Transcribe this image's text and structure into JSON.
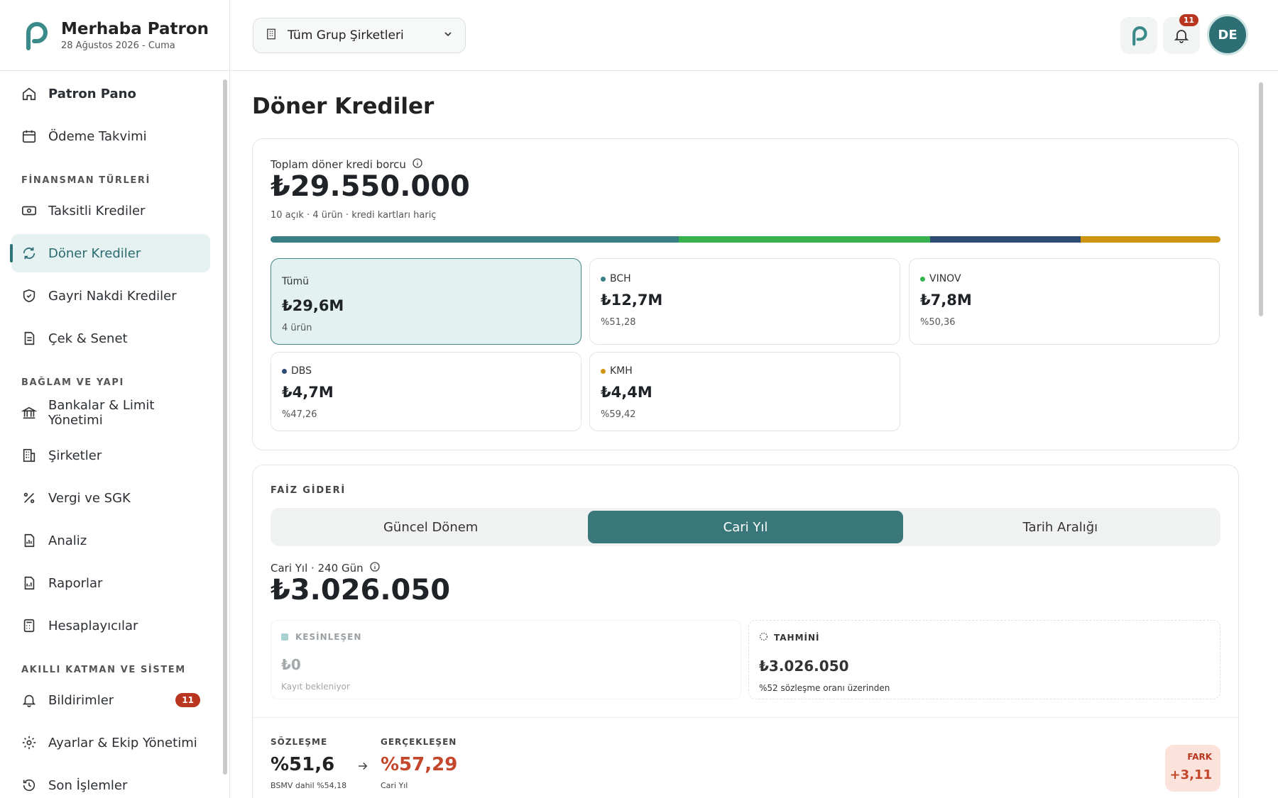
{
  "brand": {
    "title": "Merhaba Patron",
    "date": "28 Ağustos 2026 - Cuma"
  },
  "sidebar": {
    "sections": [
      "FİNANSMAN TÜRLERİ",
      "BAĞLAM VE YAPI",
      "AKILLI KATMAN VE SİSTEM"
    ],
    "items": [
      {
        "label": "Patron Pano",
        "icon": "home-icon"
      },
      {
        "label": "Ödeme Takvimi",
        "icon": "calendar-icon"
      },
      {
        "label": "Taksitli Krediler",
        "icon": "cash-icon"
      },
      {
        "label": "Döner Krediler",
        "icon": "refresh-icon"
      },
      {
        "label": "Gayri Nakdi Krediler",
        "icon": "shield-icon"
      },
      {
        "label": "Çek & Senet",
        "icon": "document-icon"
      },
      {
        "label": "Bankalar & Limit Yönetimi",
        "icon": "bank-icon"
      },
      {
        "label": "Şirketler",
        "icon": "building-icon"
      },
      {
        "label": "Vergi ve SGK",
        "icon": "percent-icon"
      },
      {
        "label": "Analiz",
        "icon": "chart-file-icon"
      },
      {
        "label": "Raporlar",
        "icon": "report-icon"
      },
      {
        "label": "Hesaplayıcılar",
        "icon": "calculator-icon"
      },
      {
        "label": "Bildirimler",
        "icon": "bell-icon",
        "badge": "11"
      },
      {
        "label": "Ayarlar & Ekip Yönetimi",
        "icon": "gear-icon"
      },
      {
        "label": "Son İşlemler",
        "icon": "history-icon"
      }
    ]
  },
  "topbar": {
    "company_select": "Tüm Grup Şirketleri",
    "notification_count": "11",
    "avatar_initials": "DE"
  },
  "page": {
    "title": "Döner Krediler"
  },
  "summary": {
    "label": "Toplam döner kredi borcu",
    "amount": "₺29.550.000",
    "note": "10 açık · 4 ürün · kredi kartları hariç",
    "bar": [
      {
        "name": "BCH",
        "share": 0.43,
        "color": "#3a7f84"
      },
      {
        "name": "VINOV",
        "share": 0.264,
        "color": "#38b24e"
      },
      {
        "name": "DBS",
        "share": 0.159,
        "color": "#2e4b73"
      },
      {
        "name": "KMH",
        "share": 0.147,
        "color": "#cf9511"
      }
    ],
    "tiles": [
      {
        "name": "Tümü",
        "value": "₺29,6M",
        "sub": "4 ürün"
      },
      {
        "name": "BCH",
        "value": "₺12,7M",
        "sub": "%51,28",
        "color": "#3a7f84"
      },
      {
        "name": "VINOV",
        "value": "₺7,8M",
        "sub": "%50,36",
        "color": "#38b24e"
      },
      {
        "name": "DBS",
        "value": "₺4,7M",
        "sub": "%47,26",
        "color": "#2e4b73"
      },
      {
        "name": "KMH",
        "value": "₺4,4M",
        "sub": "%59,42",
        "color": "#cf9511"
      }
    ]
  },
  "interest": {
    "section_label": "FAİZ GİDERİ",
    "tabs": [
      "Güncel Dönem",
      "Cari Yıl",
      "Tarih Aralığı"
    ],
    "active_tab": "Cari Yıl",
    "period_label": "Cari Yıl · 240 Gün",
    "amount": "₺3.026.050",
    "confirmed": {
      "title": "KESİNLEŞEN",
      "value": "₺0",
      "note": "Kayıt bekleniyor"
    },
    "estimated": {
      "title": "TAHMİNİ",
      "value": "₺3.026.050",
      "note": "%52 sözleşme oranı üzerinden"
    },
    "contract": {
      "title": "SÖZLEŞME",
      "value": "%51,6",
      "note": "BSMV dahil %54,18"
    },
    "realized": {
      "title": "GERÇEKLEŞEN",
      "value": "%57,29",
      "note": "Cari Yıl"
    },
    "diff": {
      "title": "FARK",
      "value": "+3,11"
    }
  }
}
